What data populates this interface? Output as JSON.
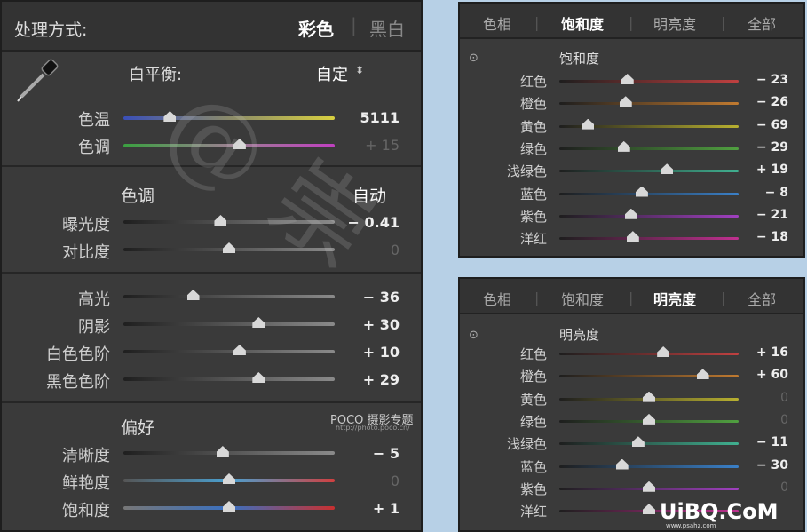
{
  "basic": {
    "header": {
      "title": "处理方式:",
      "mode_color": "彩色",
      "mode_bw": "黑白"
    },
    "wb": {
      "label": "白平衡:",
      "value": "自定"
    },
    "temp": {
      "label": "色温",
      "value": "5111",
      "pos": 0.22
    },
    "tint": {
      "label": "色调",
      "value": "+ 15",
      "pos": 0.55
    },
    "tone": {
      "title": "色调",
      "auto": "自动"
    },
    "exposure": {
      "label": "曝光度",
      "value": "− 0.41",
      "pos": 0.46
    },
    "contrast": {
      "label": "对比度",
      "value": "0",
      "pos": 0.5
    },
    "highlights": {
      "label": "高光",
      "value": "− 36",
      "pos": 0.33
    },
    "shadows": {
      "label": "阴影",
      "value": "+ 30",
      "pos": 0.64
    },
    "whites": {
      "label": "白色色阶",
      "value": "+ 10",
      "pos": 0.55
    },
    "blacks": {
      "label": "黑色色阶",
      "value": "+ 29",
      "pos": 0.64
    },
    "presence": {
      "title": "偏好"
    },
    "clarity": {
      "label": "清晰度",
      "value": "− 5",
      "pos": 0.47
    },
    "vibrance": {
      "label": "鲜艳度",
      "value": "0",
      "pos": 0.5
    },
    "saturation": {
      "label": "饱和度",
      "value": "+ 1",
      "pos": 0.5
    },
    "brand": "POCO 摄影专题",
    "brand_url": "http://photo.poco.cn/"
  },
  "tabs": {
    "hue": "色相",
    "saturation": "饱和度",
    "luminance": "明亮度",
    "all": "全部"
  },
  "sat_panel": {
    "title": "饱和度",
    "rows": [
      {
        "label": "红色",
        "value": "− 23",
        "pos": 0.38
      },
      {
        "label": "橙色",
        "value": "− 26",
        "pos": 0.37
      },
      {
        "label": "黄色",
        "value": "− 69",
        "pos": 0.16
      },
      {
        "label": "绿色",
        "value": "− 29",
        "pos": 0.36
      },
      {
        "label": "浅绿色",
        "value": "+ 19",
        "pos": 0.6
      },
      {
        "label": "蓝色",
        "value": "− 8",
        "pos": 0.46
      },
      {
        "label": "紫色",
        "value": "− 21",
        "pos": 0.4
      },
      {
        "label": "洋红",
        "value": "− 18",
        "pos": 0.41
      }
    ]
  },
  "lum_panel": {
    "title": "明亮度",
    "rows": [
      {
        "label": "红色",
        "value": "+ 16",
        "pos": 0.58
      },
      {
        "label": "橙色",
        "value": "+ 60",
        "pos": 0.8
      },
      {
        "label": "黄色",
        "value": "0",
        "pos": 0.5
      },
      {
        "label": "绿色",
        "value": "0",
        "pos": 0.5
      },
      {
        "label": "浅绿色",
        "value": "− 11",
        "pos": 0.44
      },
      {
        "label": "蓝色",
        "value": "− 30",
        "pos": 0.35
      },
      {
        "label": "紫色",
        "value": "0",
        "pos": 0.5
      },
      {
        "label": "洋红",
        "value": "",
        "pos": 0.5
      }
    ]
  },
  "watermark_right": "UiBQ.CoM",
  "watermark_small": "www.psahz.com",
  "colors": {
    "temp": "linear-gradient(90deg,#3a4fb8,#8a8a6a,#d8d040)",
    "tint": "linear-gradient(90deg,#3aa040,#9a8090,#c040c0)",
    "gray": "linear-gradient(90deg,#1f1f1f,#8a8a8a)",
    "vib": "linear-gradient(90deg,#555,#4aa0d0,#d04040)",
    "satbar": "linear-gradient(90deg,#777,#3a70c0,#c83030)",
    "hsl": [
      "#c04040",
      "#c07a30",
      "#b8b030",
      "#50a040",
      "#40b090",
      "#3a80c8",
      "#a040c0",
      "#c03090"
    ]
  }
}
